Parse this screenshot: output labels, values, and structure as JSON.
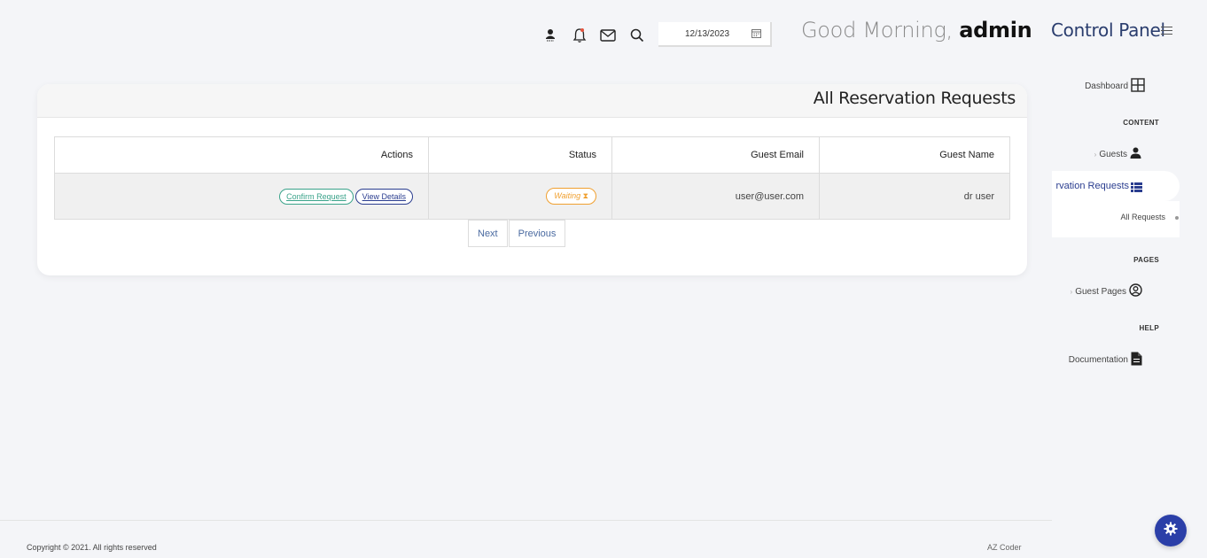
{
  "header": {
    "date_value": "12/13/2023",
    "greeting_prefix": "Good Morning,",
    "greeting_user": "admin"
  },
  "sidebar": {
    "brand": "Control Panel",
    "dashboard": "Dashboard",
    "section_content": "CONTENT",
    "guests": "Guests",
    "reservation_requests": "rvation Requests",
    "all_requests": "All Requests",
    "section_pages": "PAGES",
    "guest_pages": "Guest Pages",
    "section_help": "HELP",
    "documentation": "Documentation"
  },
  "main": {
    "title": "All Reservation Requests",
    "columns": [
      "Actions",
      "Status",
      "Guest Email",
      "Guest Name"
    ],
    "rows": [
      {
        "confirm_label": "Confirm Request",
        "view_label": "View Details",
        "status": "Waiting",
        "email": "user@user.com",
        "name": "dr user"
      }
    ],
    "pager": {
      "next": "Next",
      "previous": "Previous"
    }
  },
  "footer": {
    "copyright": "Copyright © 2021. All rights reserved",
    "author": "AZ Coder"
  },
  "colors": {
    "accent": "#2b3fa8",
    "confirm": "#3aa38a",
    "waiting": "#f0a030",
    "brand": "#2a3d6e"
  },
  "icons": [
    "user-icon",
    "bell-icon",
    "mail-icon",
    "search-icon",
    "calendar-icon",
    "hamburger-icon",
    "grid-icon",
    "person-icon",
    "list-icon",
    "user-circle-icon",
    "document-icon",
    "hourglass-icon",
    "gear-icon"
  ]
}
